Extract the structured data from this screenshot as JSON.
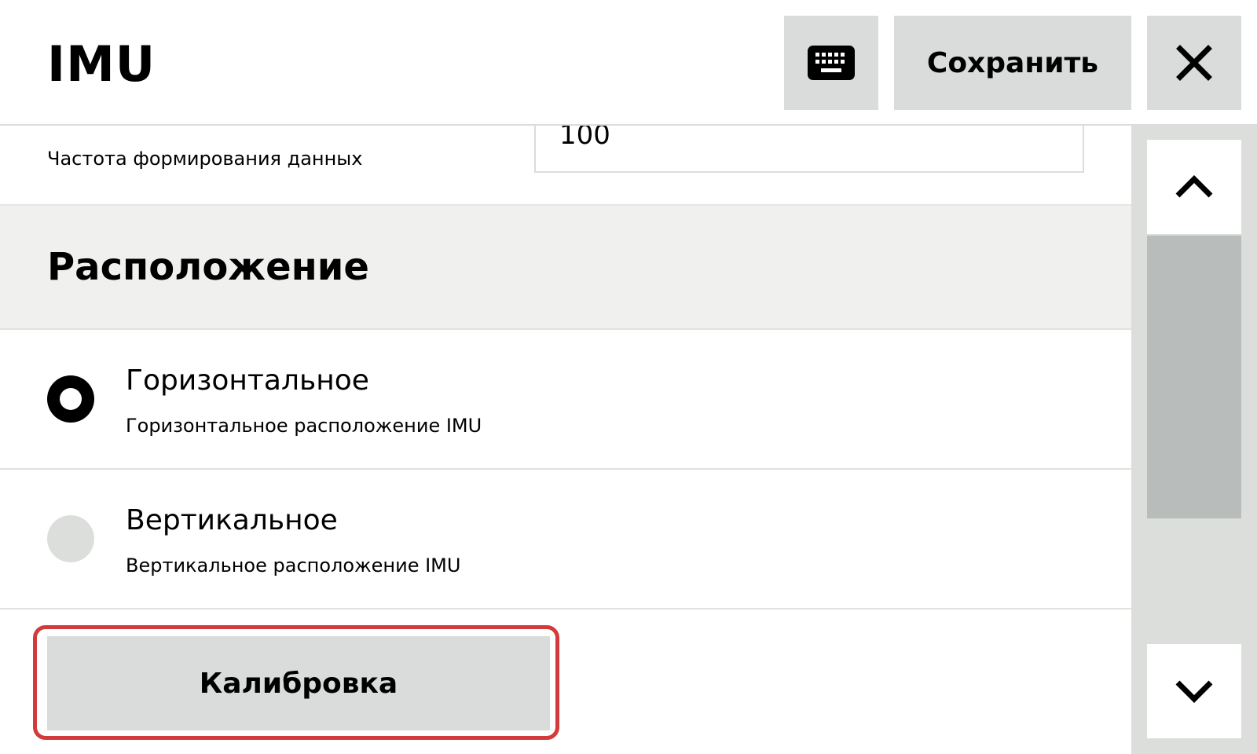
{
  "header": {
    "title": "IMU",
    "keyboard_icon": "keyboard-icon",
    "save_label": "Сохранить",
    "close_icon": "close-icon"
  },
  "field": {
    "label": "Частота формирования данных",
    "value": "100"
  },
  "section": {
    "title": "Расположение"
  },
  "options": [
    {
      "title": "Горизонтальное",
      "description": "Горизонтальное расположение IMU",
      "selected": true
    },
    {
      "title": "Вертикальное",
      "description": "Вертикальное расположение IMU",
      "selected": false
    }
  ],
  "calibration_label": "Калибровка",
  "scrollbar": {
    "up_icon": "chevron-up-icon",
    "down_icon": "chevron-down-icon"
  },
  "colors": {
    "button_bg": "#d9dcdb",
    "section_bg": "#f0f1ee",
    "highlight": "#d33a3a"
  }
}
